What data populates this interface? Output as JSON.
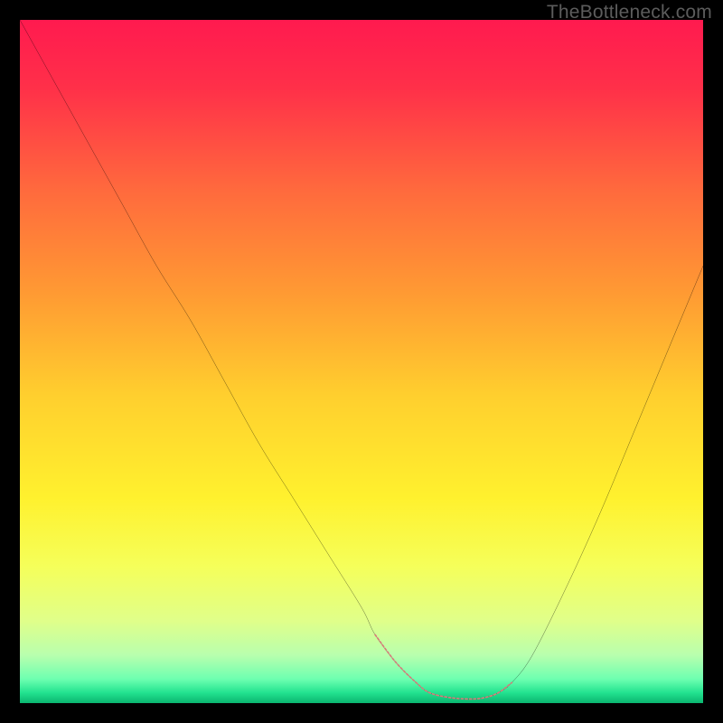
{
  "watermark": "TheBottleneck.com",
  "chart_data": {
    "type": "line",
    "title": "",
    "xlabel": "",
    "ylabel": "",
    "xlim": [
      0,
      100
    ],
    "ylim": [
      0,
      100
    ],
    "series": [
      {
        "name": "bottleneck-curve",
        "x": [
          0,
          5,
          10,
          15,
          20,
          25,
          30,
          35,
          40,
          45,
          50,
          52,
          55,
          58,
          60,
          63,
          66,
          68,
          70,
          72,
          75,
          80,
          85,
          90,
          95,
          100
        ],
        "y": [
          100,
          91,
          82,
          73,
          64,
          56,
          47,
          38,
          30,
          22,
          14,
          10,
          6,
          3,
          1.5,
          0.8,
          0.6,
          0.8,
          1.5,
          3,
          7,
          17,
          28,
          40,
          52,
          64
        ]
      }
    ],
    "highlight_segment": {
      "name": "optimal-zone",
      "color": "#d87a7a",
      "x": [
        52,
        55,
        58,
        60,
        63,
        66,
        68,
        70,
        72
      ],
      "y": [
        10,
        6,
        3,
        1.5,
        0.8,
        0.6,
        0.8,
        1.5,
        3
      ]
    },
    "gradient_stops": [
      {
        "offset": 0.0,
        "color": "#ff1a4f"
      },
      {
        "offset": 0.1,
        "color": "#ff3049"
      },
      {
        "offset": 0.25,
        "color": "#ff6a3d"
      },
      {
        "offset": 0.4,
        "color": "#ff9a33"
      },
      {
        "offset": 0.55,
        "color": "#ffcf2e"
      },
      {
        "offset": 0.7,
        "color": "#fff12e"
      },
      {
        "offset": 0.8,
        "color": "#f5ff5a"
      },
      {
        "offset": 0.88,
        "color": "#e0ff8a"
      },
      {
        "offset": 0.93,
        "color": "#b8ffae"
      },
      {
        "offset": 0.965,
        "color": "#6dffb0"
      },
      {
        "offset": 0.985,
        "color": "#22e28f"
      },
      {
        "offset": 1.0,
        "color": "#0ab56f"
      }
    ]
  }
}
